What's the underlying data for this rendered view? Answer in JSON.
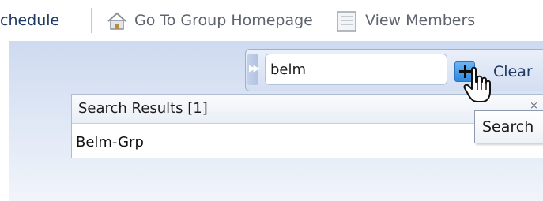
{
  "toolbar": {
    "schedule_label": "chedule",
    "group_homepage_label": "Go To Group Homepage",
    "view_members_label": "View Members",
    "home_icon": "home-icon",
    "members_icon": "document-list-icon"
  },
  "search": {
    "value": "belm",
    "button_label": "+",
    "clear_label": "Clear",
    "tooltip": "Search"
  },
  "results": {
    "header": "Search Results [1]",
    "items": [
      "Belm-Grp"
    ]
  },
  "colors": {
    "link": "#1f3a66",
    "panel_background": "#dce5f4",
    "search_button": "#2f87db"
  }
}
